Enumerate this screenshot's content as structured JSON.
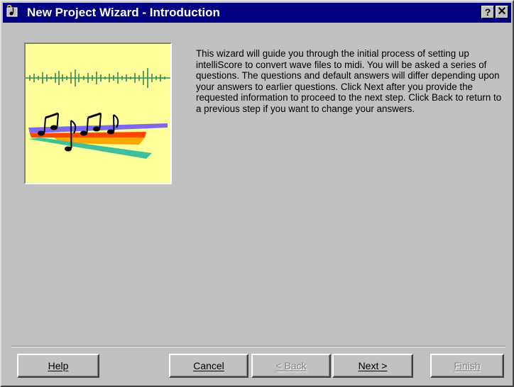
{
  "window": {
    "title": "New Project Wizard - Introduction",
    "help_glyph": "?",
    "close_glyph": "✕"
  },
  "intro": {
    "text": "This wizard will guide you through the initial process of setting up intelliScore to convert wave files to midi. You will be asked a series of questions. The questions and default answers will differ depending upon your answers to earlier questions. Click Next after you provide the requested information to proceed to the next step. Click Back to return to a previous step if you want to change your answers."
  },
  "picture": {
    "background": "#ffff99",
    "waveform_color": "#2e8b57",
    "stripe_colors": [
      "#7b68ee",
      "#ff4500",
      "#ffa500",
      "#40c09a"
    ],
    "notes_icon": "music-notes-icon"
  },
  "buttons": {
    "help": "Help",
    "cancel": "Cancel",
    "back": "< Back",
    "next": "Next >",
    "finish": "Finish"
  },
  "button_state": {
    "back_enabled": false,
    "finish_enabled": false
  }
}
